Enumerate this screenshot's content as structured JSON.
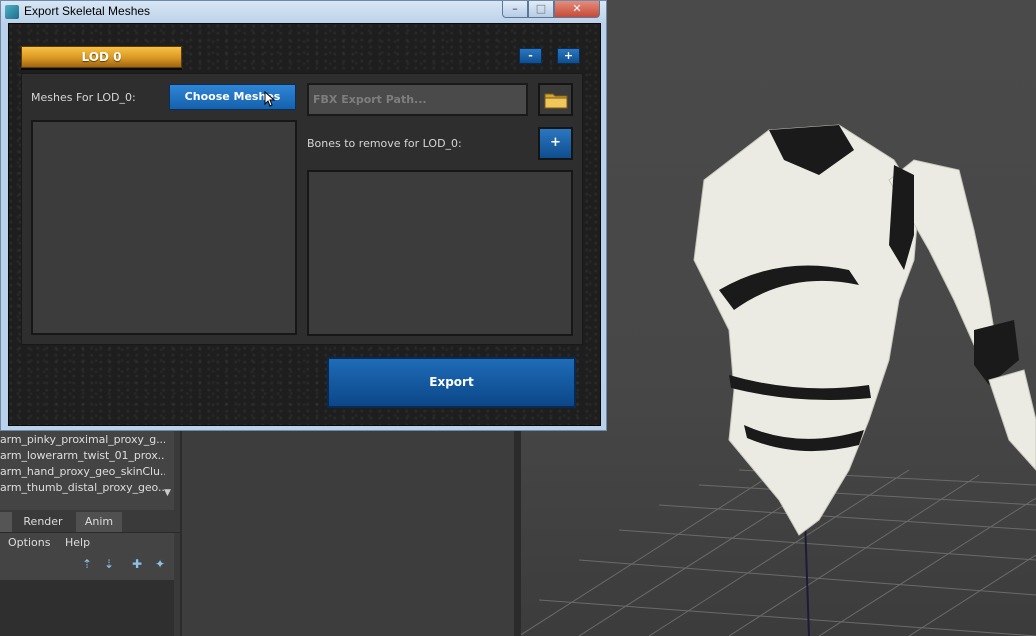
{
  "dialog": {
    "title": "Export Skeletal Meshes",
    "window_controls": {
      "minimize": "–",
      "maximize": "□",
      "close": "✕"
    },
    "lod_label": "LOD 0",
    "remove_lod_label": "-",
    "add_lod_label": "+",
    "meshes_label": "Meshes For LOD_0:",
    "choose_meshes_label": "Choose Meshes",
    "fbx_path_placeholder": "FBX Export Path...",
    "bones_label": "Bones to remove for LOD_0:",
    "add_bone_label": "+",
    "export_label": "Export"
  },
  "outliner": {
    "items": [
      "arm_pinky_proximal_proxy_g...",
      "arm_lowerarm_twist_01_prox...",
      "arm_hand_proxy_geo_skinClu...",
      "arm_thumb_distal_proxy_geo..."
    ]
  },
  "bottom_tabs": [
    "Render",
    "Anim"
  ],
  "bottom_menu": [
    "Options",
    "Help"
  ],
  "colors": {
    "accent_blue": "#1561ad",
    "lod_gold": "#d99722",
    "dialog_bg": "#1e1e1e"
  }
}
